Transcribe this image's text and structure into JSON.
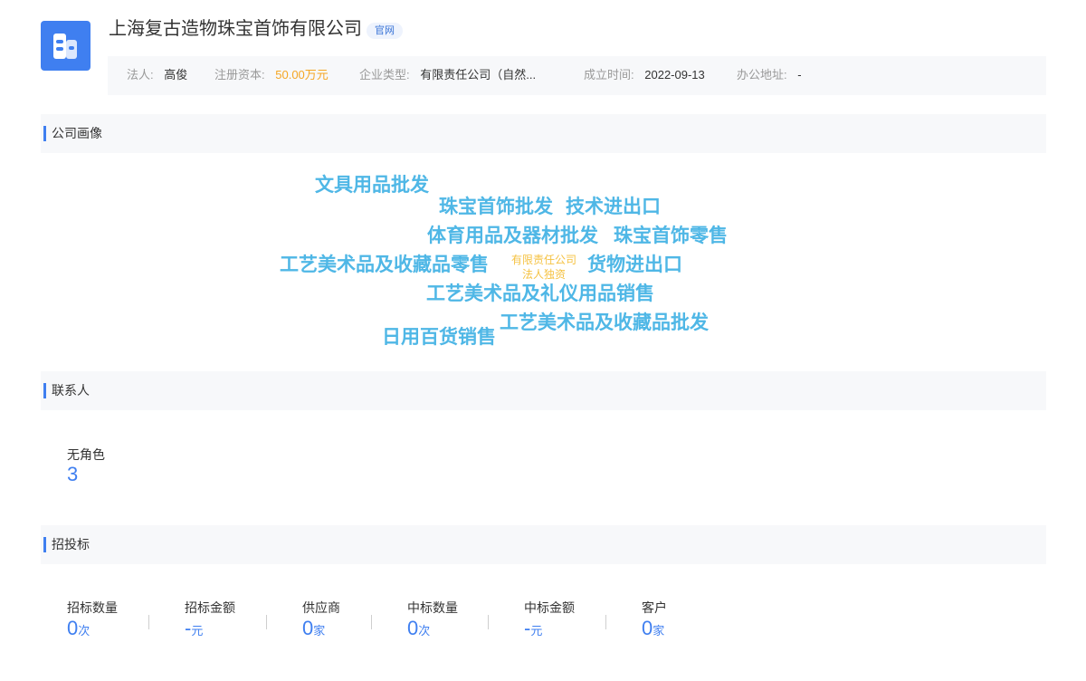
{
  "header": {
    "company_name": "上海复古造物珠宝首饰有限公司",
    "official_badge": "官网",
    "logo_icon": "building-icon",
    "accent_color": "#3f7ff0"
  },
  "info": {
    "legal_rep_label": "法人:",
    "legal_rep": "高俊",
    "capital_label": "注册资本:",
    "capital": "50.00万元",
    "type_label": "企业类型:",
    "type": "有限责任公司（自然...",
    "founded_label": "成立时间:",
    "founded": "2022-09-13",
    "address_label": "办公地址:",
    "address": "-"
  },
  "portrait": {
    "title": "公司画像",
    "words": [
      "文具用品批发",
      "珠宝首饰批发",
      "技术进出口",
      "体育用品及器材批发",
      "珠宝首饰零售",
      "工艺美术品及收藏品零售",
      "有限责任公司",
      "法人独资",
      "货物进出口",
      "工艺美术品及礼仪用品销售",
      "工艺美术品及收藏品批发",
      "日用百货销售"
    ]
  },
  "contacts": {
    "title": "联系人",
    "role_label": "无角色",
    "role_count": "3"
  },
  "bidding": {
    "title": "招投标",
    "stats": [
      {
        "label": "招标数量",
        "value": "0",
        "unit": "次"
      },
      {
        "label": "招标金额",
        "value": "-",
        "unit": "元"
      },
      {
        "label": "供应商",
        "value": "0",
        "unit": "家"
      },
      {
        "label": "中标数量",
        "value": "0",
        "unit": "次"
      },
      {
        "label": "中标金额",
        "value": "-",
        "unit": "元"
      },
      {
        "label": "客户",
        "value": "0",
        "unit": "家"
      }
    ]
  }
}
